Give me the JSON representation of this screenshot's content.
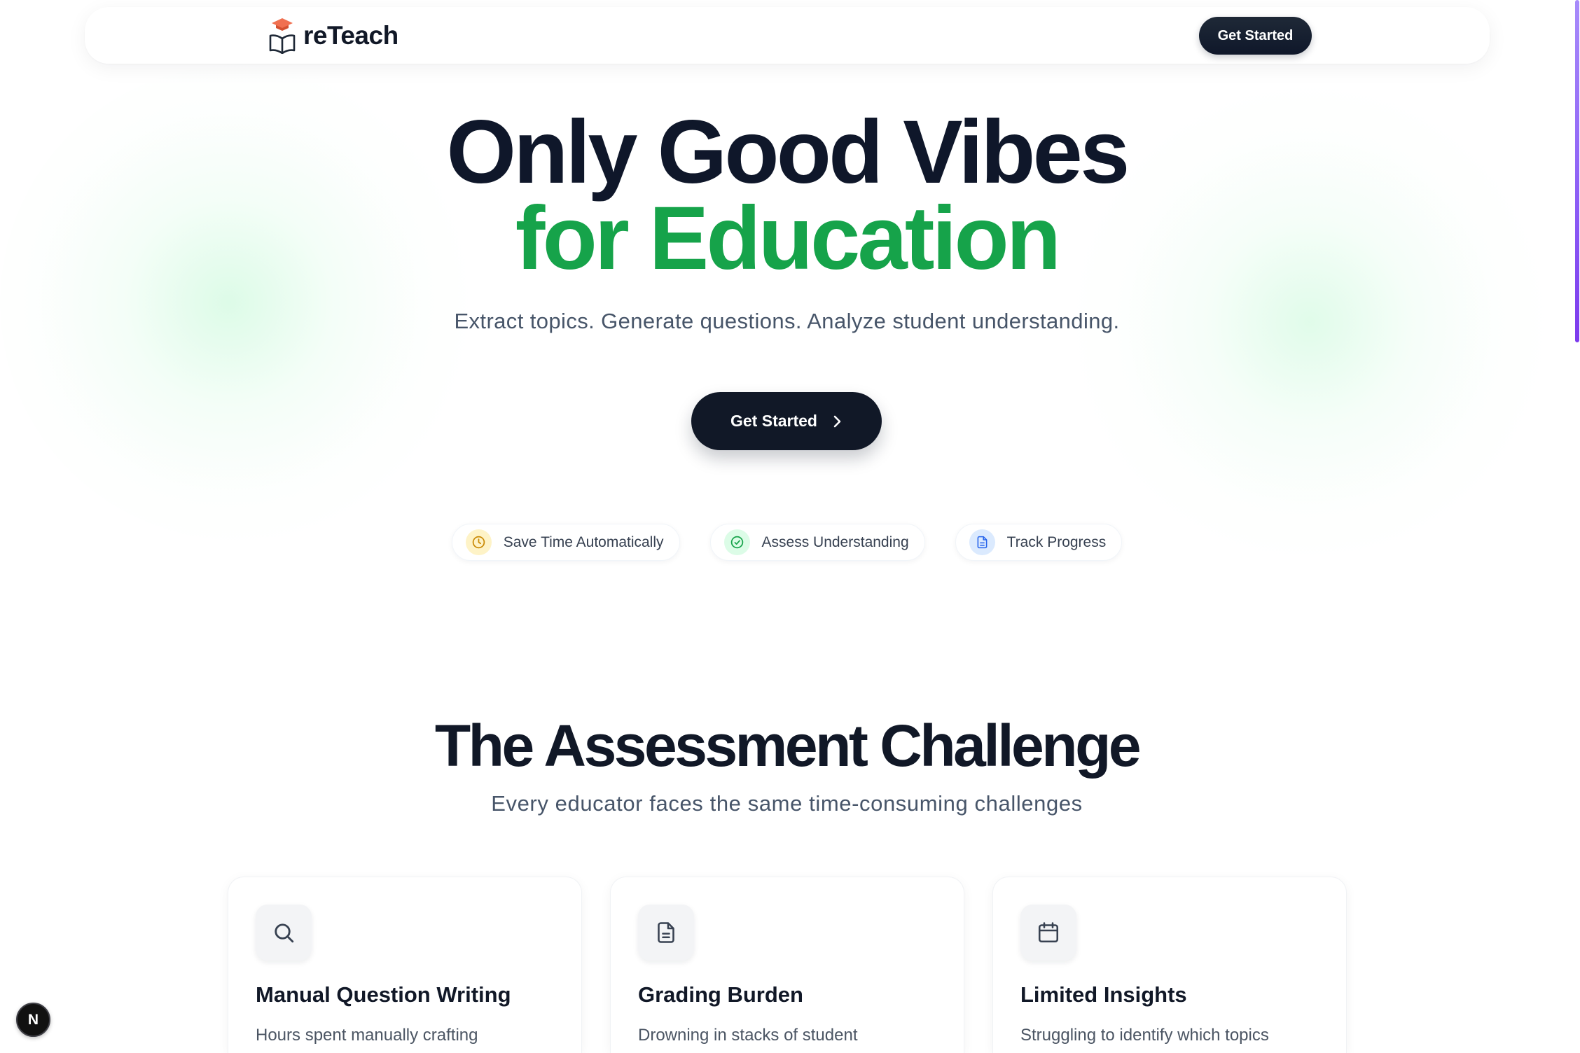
{
  "nav": {
    "brand": "reTeach",
    "cta_label": "Get Started"
  },
  "hero": {
    "title_line1": "Only Good Vibes",
    "title_line2": "for Education",
    "subtitle": "Extract topics. Generate questions. Analyze student understanding.",
    "cta_label": "Get Started",
    "pills": [
      {
        "label": "Save Time Automatically",
        "icon": "clock-icon",
        "color": "#ca8a04"
      },
      {
        "label": "Assess Understanding",
        "icon": "check-circle-icon",
        "color": "#16a34a"
      },
      {
        "label": "Track Progress",
        "icon": "document-icon",
        "color": "#2563eb"
      }
    ]
  },
  "challenge": {
    "title": "The Assessment Challenge",
    "subtitle": "Every educator faces the same time-consuming challenges",
    "cards": [
      {
        "icon": "search-icon",
        "title": "Manual Question Writing",
        "body": "Hours spent manually crafting"
      },
      {
        "icon": "file-text-icon",
        "title": "Grading Burden",
        "body": "Drowning in stacks of student"
      },
      {
        "icon": "calendar-icon",
        "title": "Limited Insights",
        "body": "Struggling to identify which topics"
      }
    ]
  },
  "dev_indicator": {
    "label": "N"
  },
  "theme": {
    "text_dark": "#0f172a",
    "accent": "#16a34a",
    "button_dark": "#111827",
    "text_muted": "#475569",
    "scrollbar": "#8b5cf6"
  }
}
